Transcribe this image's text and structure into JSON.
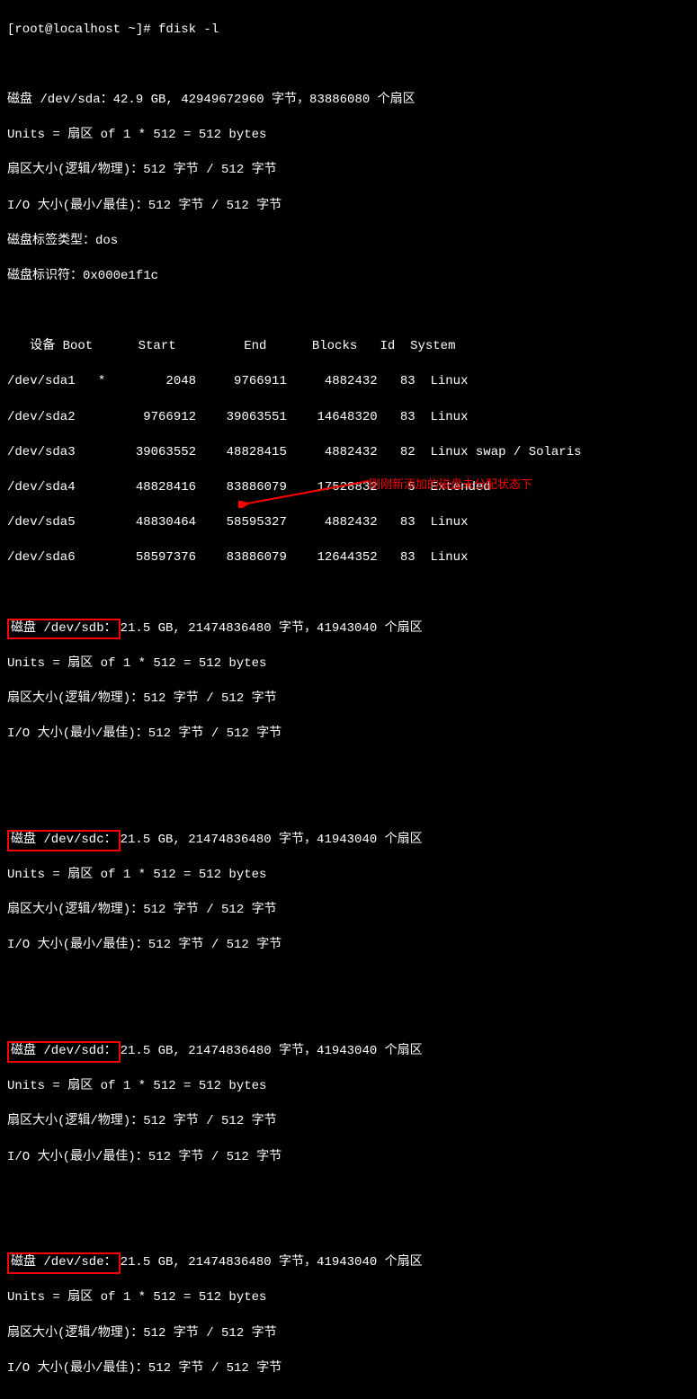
{
  "prompt": "[root@localhost ~]# fdisk -l",
  "sda": {
    "header": "磁盘 /dev/sda：42.9 GB, 42949672960 字节，83886080 个扇区",
    "units": "Units = 扇区 of 1 * 512 = 512 bytes",
    "sector": "扇区大小(逻辑/物理)：512 字节 / 512 字节",
    "io": "I/O 大小(最小/最佳)：512 字节 / 512 字节",
    "label": "磁盘标签类型：dos",
    "ident": "磁盘标识符：0x000e1f1c"
  },
  "table_header": "   设备 Boot      Start         End      Blocks   Id  System",
  "partitions": {
    "p1": "/dev/sda1   *        2048     9766911     4882432   83  Linux",
    "p2": "/dev/sda2         9766912    39063551    14648320   83  Linux",
    "p3": "/dev/sda3        39063552    48828415     4882432   82  Linux swap / Solaris",
    "p4": "/dev/sda4        48828416    83886079    17528832    5  Extended",
    "p5": "/dev/sda5        48830464    58595327     4882432   83  Linux",
    "p6": "/dev/sda6        58597376    83886079    12644352   83  Linux"
  },
  "sdb": {
    "label": "磁盘 /dev/sdb：",
    "rest": "21.5 GB, 21474836480 字节，41943040 个扇区",
    "units": "Units = 扇区 of 1 * 512 = 512 bytes",
    "sector": "扇区大小(逻辑/物理)：512 字节 / 512 字节",
    "io": "I/O 大小(最小/最佳)：512 字节 / 512 字节"
  },
  "sdc": {
    "label": "磁盘 /dev/sdc：",
    "rest": "21.5 GB, 21474836480 字节，41943040 个扇区",
    "units": "Units = 扇区 of 1 * 512 = 512 bytes",
    "sector": "扇区大小(逻辑/物理)：512 字节 / 512 字节",
    "io": "I/O 大小(最小/最佳)：512 字节 / 512 字节"
  },
  "sdd": {
    "label": "磁盘 /dev/sdd：",
    "rest": "21.5 GB, 21474836480 字节，41943040 个扇区",
    "units": "Units = 扇区 of 1 * 512 = 512 bytes",
    "sector": "扇区大小(逻辑/物理)：512 字节 / 512 字节",
    "io": "I/O 大小(最小/最佳)：512 字节 / 512 字节"
  },
  "sde": {
    "label": "磁盘 /dev/sde：",
    "rest": "21.5 GB, 21474836480 字节，41943040 个扇区",
    "units": "Units = 扇区 of 1 * 512 = 512 bytes",
    "sector": "扇区大小(逻辑/物理)：512 字节 / 512 字节",
    "io": "I/O 大小(最小/最佳)：512 字节 / 512 字节"
  },
  "annotation": "刚刚新添加的磁盘未分配状态下"
}
